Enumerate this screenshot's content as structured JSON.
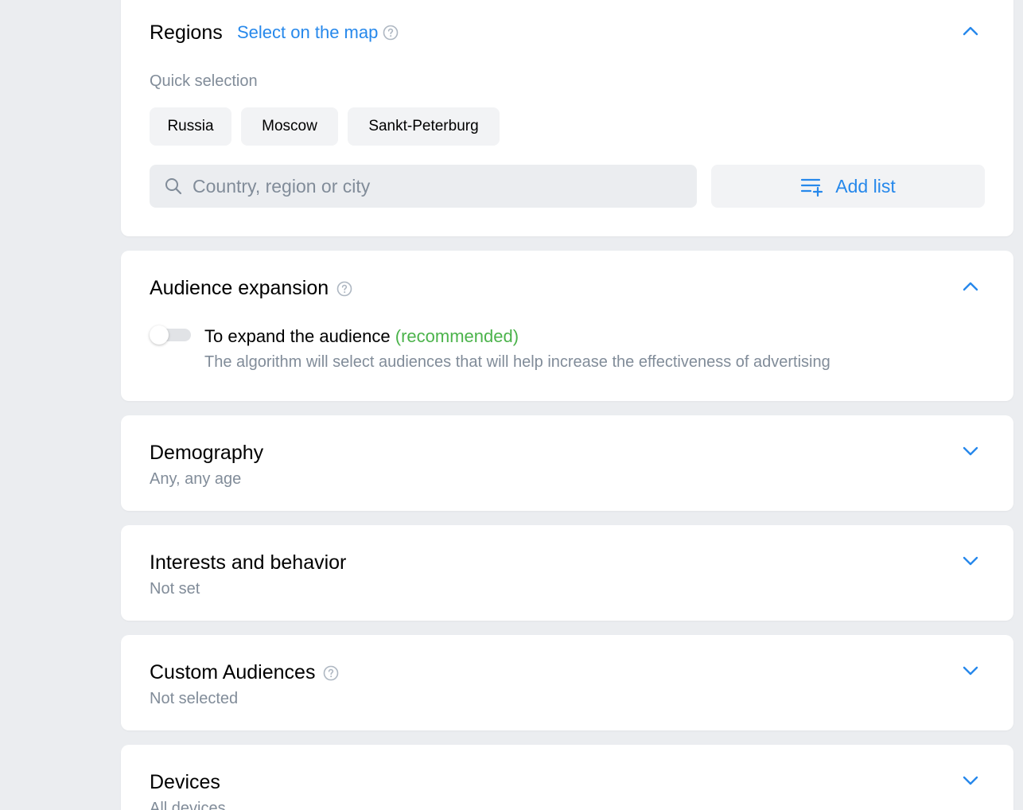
{
  "regions": {
    "title": "Regions",
    "map_link": "Select on the map",
    "quick_label": "Quick selection",
    "chips": [
      "Russia",
      "Moscow",
      "Sankt-Peterburg"
    ],
    "search_placeholder": "Country, region or city",
    "search_value": "",
    "add_list_label": "Add list",
    "expanded": true
  },
  "audience_expansion": {
    "title": "Audience expansion",
    "toggle_label": "To expand the audience",
    "toggle_recommended": "(recommended)",
    "toggle_on": false,
    "toggle_desc": "The algorithm will select audiences that will help increase the effectiveness of advertising",
    "expanded": true
  },
  "demography": {
    "title": "Demography",
    "subtitle": "Any, any age",
    "expanded": false
  },
  "interests": {
    "title": "Interests and behavior",
    "subtitle": "Not set",
    "expanded": false
  },
  "custom_audiences": {
    "title": "Custom Audiences",
    "subtitle": "Not selected",
    "expanded": false
  },
  "devices": {
    "title": "Devices",
    "subtitle": "All devices",
    "expanded": false
  },
  "colors": {
    "accent": "#2688eb",
    "recommended": "#4bb34b",
    "secondary_text": "#818c99",
    "background": "#ebedf0"
  },
  "icons": {
    "help": "question-circle-icon",
    "search": "search-icon",
    "add_list": "list-add-icon",
    "collapse": "chevron-up-icon",
    "expand": "chevron-down-icon"
  }
}
